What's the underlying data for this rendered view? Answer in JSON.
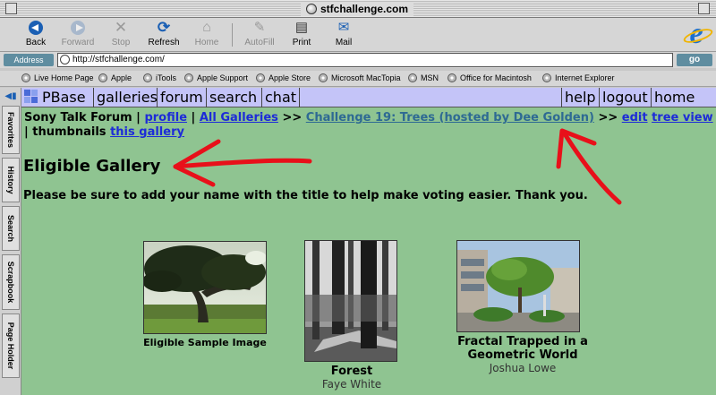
{
  "window": {
    "title": "stfchallenge.com"
  },
  "toolbar": {
    "buttons": [
      {
        "label": "Back",
        "icon": "back-arrow-icon"
      },
      {
        "label": "Forward",
        "icon": "forward-arrow-icon"
      },
      {
        "label": "Stop",
        "icon": "stop-icon"
      },
      {
        "label": "Refresh",
        "icon": "refresh-icon"
      },
      {
        "label": "Home",
        "icon": "home-icon"
      },
      {
        "label": "AutoFill",
        "icon": "autofill-icon"
      },
      {
        "label": "Print",
        "icon": "print-icon"
      },
      {
        "label": "Mail",
        "icon": "mail-icon"
      }
    ]
  },
  "address": {
    "label": "Address",
    "url": "http://stfchallenge.com/",
    "go": "go"
  },
  "favorites": [
    "Live Home Page",
    "Apple",
    "iTools",
    "Apple Support",
    "Apple Store",
    "Microsoft MacTopia",
    "MSN",
    "Office for Macintosh",
    "Internet Explorer"
  ],
  "side_tabs": [
    "Favorites",
    "History",
    "Search",
    "Scrapbook",
    "Page Holder"
  ],
  "nav": {
    "logo": "PBase",
    "left": [
      "galleries",
      "forum",
      "search",
      "chat"
    ],
    "right": [
      "help",
      "logout",
      "home"
    ]
  },
  "breadcrumb": {
    "site": "Sony Talk Forum",
    "sep1": "|",
    "profile": "profile",
    "sep2": "|",
    "all_galleries": "All Galleries",
    "arrow1": ">>",
    "challenge": "Challenge 19: Trees (hosted by Dee Golden)",
    "arrow2": ">>",
    "edit": "edit",
    "tree_view": "tree view",
    "sep3": "|",
    "thumbnails": "thumbnails",
    "this_gallery": "this gallery"
  },
  "gallery": {
    "title": "Eligible Gallery",
    "description": "Please be sure to add your name with the title to help make voting easier. Thank you."
  },
  "thumbnails": [
    {
      "caption": "Eligible Sample Image",
      "author": ""
    },
    {
      "caption": "Forest",
      "author": "Faye White"
    },
    {
      "caption": "Fractal Trapped in a Geometric World",
      "author": "Joshua Lowe"
    }
  ],
  "colors": {
    "page_bg": "#8fc491",
    "nav_bg": "#c4c4f8",
    "link": "#1d2bd8",
    "annotation_arrow": "#e8101a"
  }
}
